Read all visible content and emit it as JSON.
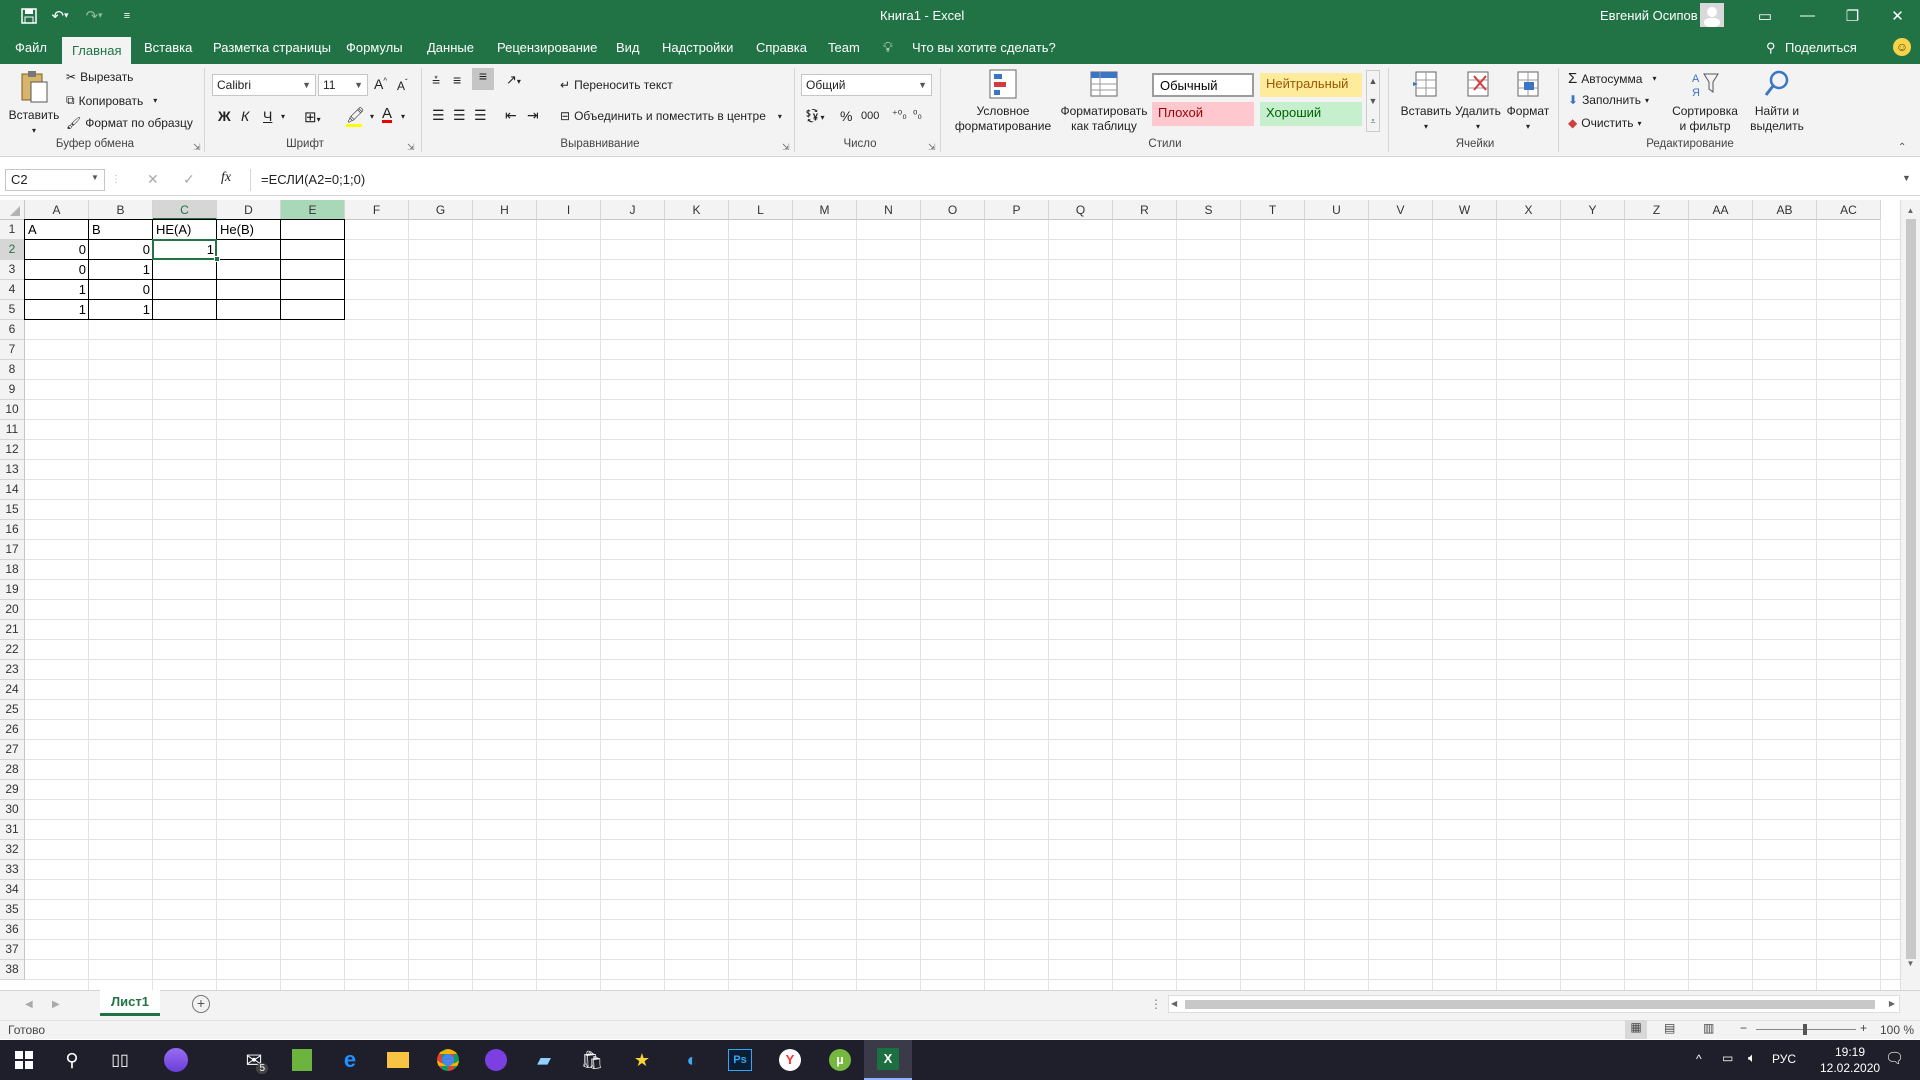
{
  "titlebar": {
    "title": "Книга1 - Excel",
    "user": "Евгений Осипов"
  },
  "tabs": [
    "Файл",
    "Главная",
    "Вставка",
    "Разметка страницы",
    "Формулы",
    "Данные",
    "Рецензирование",
    "Вид",
    "Надстройки",
    "Справка",
    "Team"
  ],
  "tellme": "Что вы хотите сделать?",
  "share": "Поделиться",
  "ribbon": {
    "clipboard": {
      "paste": "Вставить",
      "cut": "Вырезать",
      "copy": "Копировать",
      "format_painter": "Формат по образцу",
      "label": "Буфер обмена"
    },
    "font": {
      "name": "Calibri",
      "size": "11",
      "bold": "Ж",
      "italic": "К",
      "underline": "Ч",
      "label": "Шрифт"
    },
    "alignment": {
      "wrap": "Переносить текст",
      "merge": "Объединить и поместить в центре",
      "label": "Выравнивание"
    },
    "number": {
      "format": "Общий",
      "percent": "%",
      "thousands": "000",
      "label": "Число"
    },
    "styles": {
      "cond": "Условное форматирование",
      "table": "Форматировать как таблицу",
      "normal": "Обычный",
      "neutral": "Нейтральный",
      "bad": "Плохой",
      "good": "Хороший",
      "label": "Стили"
    },
    "cells": {
      "insert": "Вставить",
      "delete": "Удалить",
      "format": "Формат",
      "label": "Ячейки"
    },
    "editing": {
      "autosum": "Автосумма",
      "fill": "Заполнить",
      "clear": "Очистить",
      "sort": "Сортировка и фильтр",
      "find": "Найти и выделить",
      "label": "Редактирование"
    }
  },
  "formula_bar": {
    "name_box": "C2",
    "formula": "=ЕСЛИ(A2=0;1;0)",
    "fx": "fx"
  },
  "columns": [
    "A",
    "B",
    "C",
    "D",
    "E",
    "F",
    "G",
    "H",
    "I",
    "J",
    "K",
    "L",
    "M",
    "N",
    "O",
    "P",
    "Q",
    "R",
    "S",
    "T",
    "U",
    "V",
    "W",
    "X",
    "Y",
    "Z",
    "AA",
    "AB",
    "AC"
  ],
  "rows": [
    "1",
    "2",
    "3",
    "4",
    "5",
    "6",
    "7",
    "8",
    "9",
    "10",
    "11",
    "12",
    "13",
    "14",
    "15",
    "16",
    "17",
    "18",
    "19",
    "20",
    "21",
    "22",
    "23",
    "24",
    "25",
    "26",
    "27",
    "28",
    "29",
    "30",
    "31",
    "32",
    "33",
    "34",
    "35",
    "36",
    "37",
    "38"
  ],
  "cells": {
    "A1": "A",
    "B1": "B",
    "C1": "НЕ(A)",
    "D1": "Не(B)",
    "A2": "0",
    "B2": "0",
    "C2": "1",
    "A3": "0",
    "B3": "1",
    "A4": "1",
    "B4": "0",
    "A5": "1",
    "B5": "1"
  },
  "sheet_tab": "Лист1",
  "status": {
    "ready": "Готово",
    "zoom": "100 %"
  },
  "taskbar": {
    "lang": "РУС",
    "time": "19:19",
    "date": "12.02.2020",
    "mail_badge": "5"
  }
}
